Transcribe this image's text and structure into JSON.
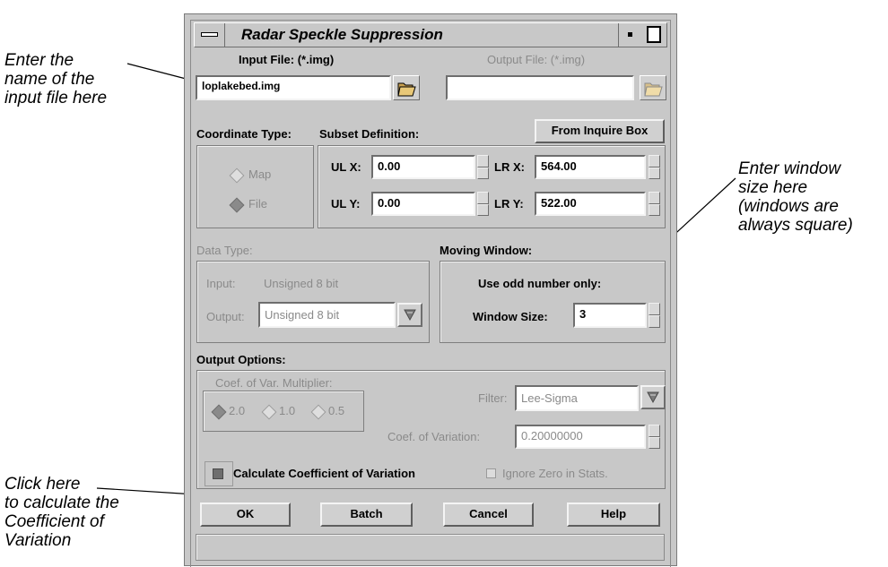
{
  "annotations": {
    "input_file": "Enter the\nname of the\ninput file here",
    "window_size": "Enter window\nsize here\n(windows are\nalways square)",
    "coef_variation": "Click here\nto calculate the\nCoefficient of\nVariation"
  },
  "window": {
    "title": "Radar Speckle Suppression"
  },
  "files": {
    "input_label": "Input File: (*.img)",
    "output_label": "Output File: (*.img)",
    "input_value": "loplakebed.img",
    "output_value": ""
  },
  "coord": {
    "type_label": "Coordinate Type:",
    "subset_label": "Subset Definition:",
    "inquire_button": "From Inquire Box",
    "map_label": "Map",
    "file_label": "File",
    "selected": "File",
    "ulx_label": "UL X:",
    "ulx_value": "0.00",
    "lrx_label": "LR X:",
    "lrx_value": "564.00",
    "uly_label": "UL Y:",
    "uly_value": "0.00",
    "lry_label": "LR Y:",
    "lry_value": "522.00"
  },
  "data_type": {
    "label": "Data Type:",
    "input_label": "Input:",
    "input_value": "Unsigned 8 bit",
    "output_label": "Output:",
    "output_value": "Unsigned 8 bit"
  },
  "moving_window": {
    "label": "Moving Window:",
    "note": "Use odd number only:",
    "size_label": "Window Size:",
    "size_value": "3"
  },
  "output_options": {
    "label": "Output Options:",
    "coef_multiplier_label": "Coef. of Var. Multiplier:",
    "mult_options": [
      "2.0",
      "1.0",
      "0.5"
    ],
    "mult_selected": "2.0",
    "filter_label": "Filter:",
    "filter_value": "Lee-Sigma",
    "coef_variation_label": "Coef. of Variation:",
    "coef_variation_value": "0.20000000",
    "calc_label": "Calculate Coefficient of Variation",
    "ignore_zero_label": "Ignore Zero in Stats."
  },
  "buttons": {
    "ok": "OK",
    "batch": "Batch",
    "cancel": "Cancel",
    "help": "Help"
  }
}
